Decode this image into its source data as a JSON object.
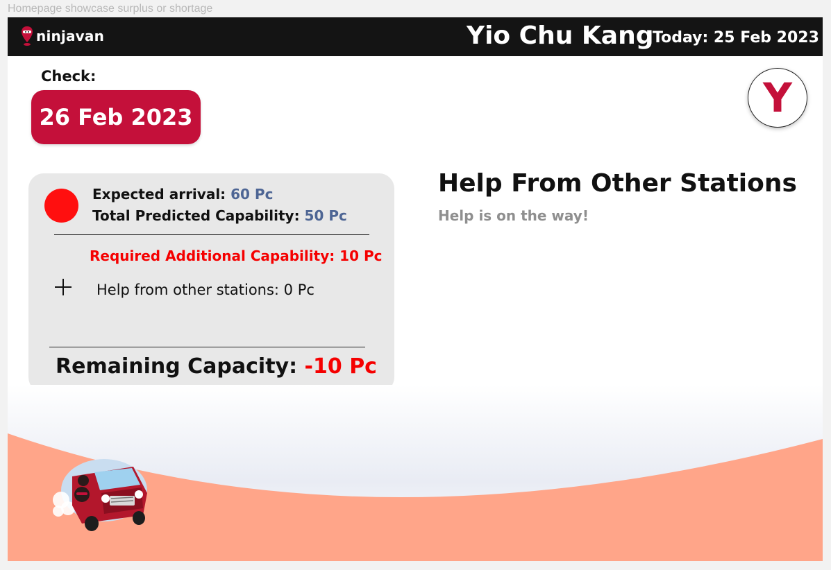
{
  "canvas_caption": "Homepage showcase surplus or shortage",
  "header": {
    "logo_text": "ninjavan",
    "station_name": "Yio Chu Kang",
    "today": "Today: 25 Feb 2023",
    "logo_icon": "ninja-pin-icon"
  },
  "check": {
    "label": "Check:",
    "date": "26 Feb 2023"
  },
  "avatar": {
    "initial": "Y"
  },
  "summary": {
    "status_color": "#ff0f0f",
    "expected_label": "Expected arrival: ",
    "expected_value": "60 Pc",
    "capability_label": "Total Predicted Capability: ",
    "capability_value": "50 Pc",
    "required": "Required Additional Capability: 10 Pc",
    "help_line": "Help from other stations: 0 Pc",
    "remaining_label": "Remaining Capacity: ",
    "remaining_value": "-10 Pc"
  },
  "help_panel": {
    "title": "Help From Other Stations",
    "subtitle": "Help is on the way!"
  },
  "colors": {
    "brand": "#c4103a",
    "header_bg": "#141414",
    "wave": "#ffa589",
    "negative": "#f50000",
    "value_blue": "#4d6594"
  },
  "illustration": "delivery-van-illustration"
}
